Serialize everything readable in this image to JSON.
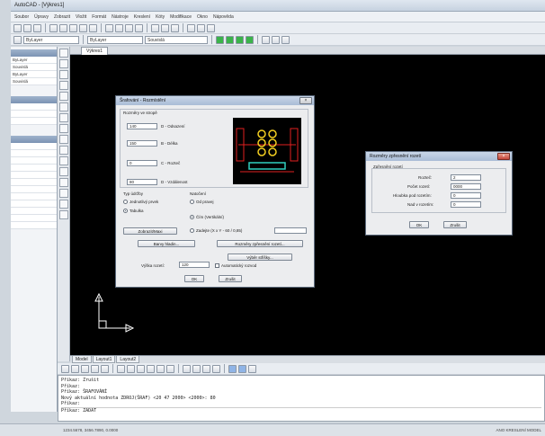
{
  "window": {
    "title": "AutoCAD - [Výkres1]"
  },
  "menu": [
    "Soubor",
    "Úpravy",
    "Zobrazit",
    "Vložit",
    "Formát",
    "Nástroje",
    "Kreslení",
    "Kóty",
    "Modifikace",
    "Okno",
    "Nápověda"
  ],
  "toolbar2": {
    "layer_combo": "ByLayer",
    "color_combo": "ByLayer",
    "linetype_combo": "Souvislá"
  },
  "drawing_tab": "Výkres1",
  "layout_tabs": [
    "Model",
    "Layout1",
    "Layout2"
  ],
  "left_panel": {
    "rows": [
      "ByLayer",
      "Souvislá",
      "ByLayer",
      "Souvislá",
      "0"
    ]
  },
  "dialog_main": {
    "title": "Šrafování - Rozmístění",
    "group_label": "Rozměry ve stropě",
    "fields": [
      {
        "value": "140",
        "label": "D - Odsazení"
      },
      {
        "value": "150",
        "label": "B - Délka"
      },
      {
        "value": "0",
        "label": "C - Rozteč"
      },
      {
        "value": "80",
        "label": "D - Vzdálenost"
      }
    ],
    "type_label": "Typ údržby",
    "type_opts": [
      "Jednotlivý prvek",
      "Tabulka"
    ],
    "rot_label": "Natočení",
    "rot_opts": [
      "Od pravej",
      "Čím (Vertikální)"
    ],
    "extra_field": "Zadejte (X x Y - 60 / 0,85)",
    "btn_zobrazit": "Zobrazit/Maxi",
    "btn_barvy": "Barvy hladin...",
    "btn_rozmery": "Rozměry zpřesnění rozetí...",
    "btn_vyber": "Výběr stříšky...",
    "height_label": "Výška rozetí:",
    "height_value": "120",
    "check_label": "Automatický rozvod",
    "ok": "OK",
    "cancel": "Zrušit"
  },
  "dialog_small": {
    "title": "Rozměry zpřesnění rozetí",
    "group_label": "Zpřesnění rozetí",
    "fields": [
      {
        "label": "Rozteč:",
        "value": "2"
      },
      {
        "label": "Počet rozetí:",
        "value": "0000"
      },
      {
        "label": "Hloubka pod rozetím:",
        "value": "0"
      },
      {
        "label": "Nad v rozetím:",
        "value": "0"
      }
    ],
    "ok": "OK",
    "cancel": "Zrušit"
  },
  "command_lines": [
    "Příkaz: Zrušit",
    "Příkaz:",
    "Příkaz: ŠRAFOVÁNÍ",
    "Nový aktuální hodnota ZDROJ(ŠRAF) <20 47 2000> <2000>: 80",
    "Příkaz:",
    "Příkaz: ZADAT"
  ],
  "status": {
    "left": "1234.5678, 3456.7890, 0.0000",
    "right": "ANO  KRESLENÍ  MODEL"
  }
}
